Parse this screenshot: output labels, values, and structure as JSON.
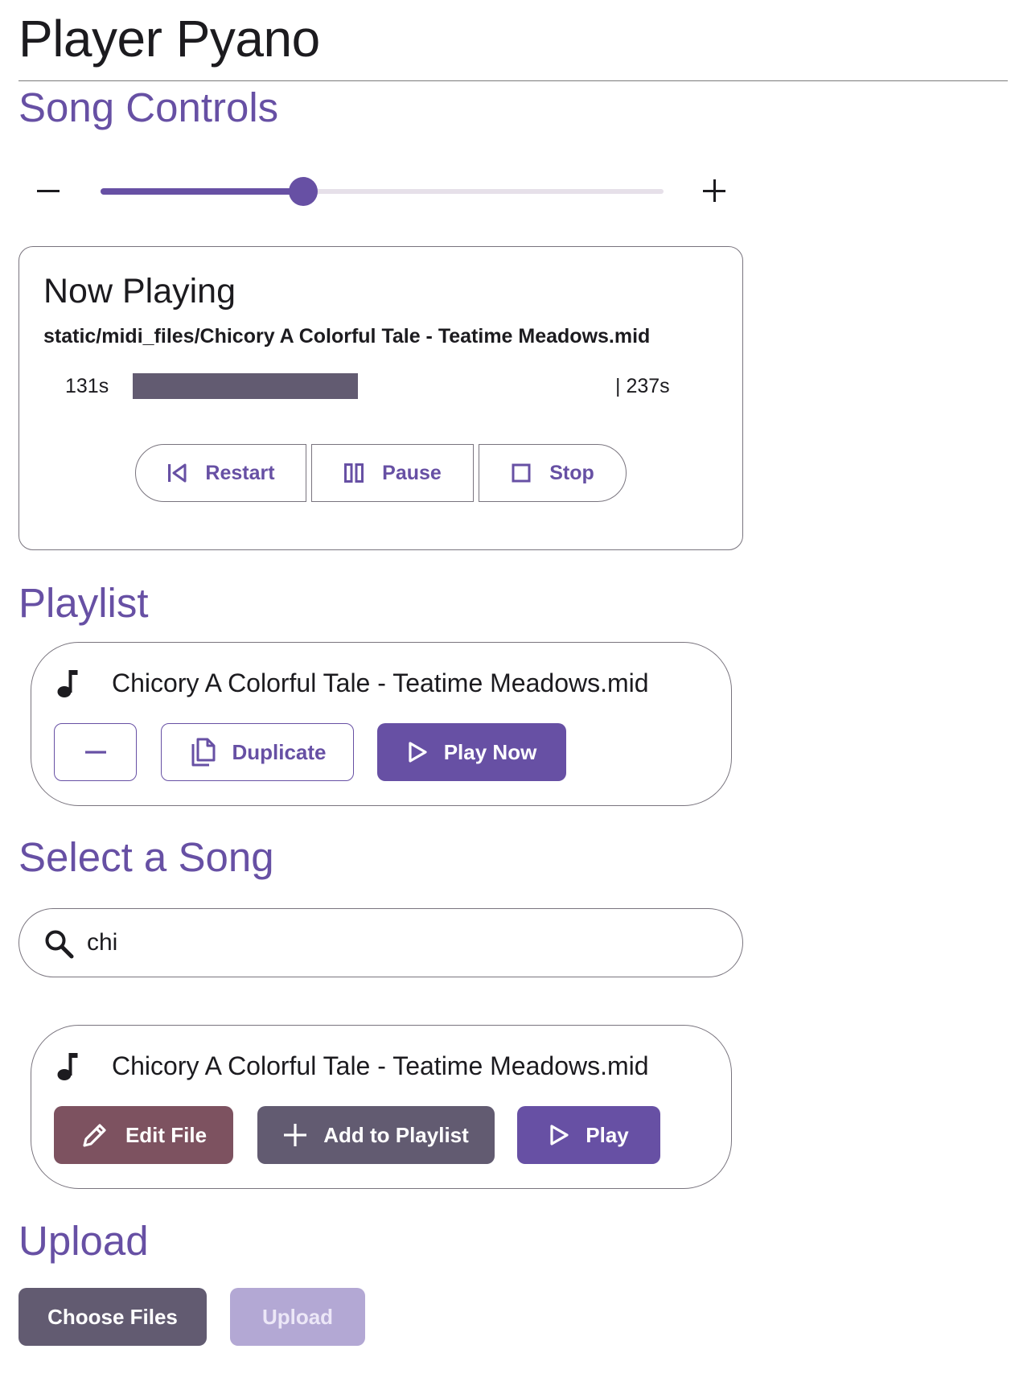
{
  "app": {
    "title": "Player Pyano"
  },
  "song_controls": {
    "heading": "Song Controls",
    "volume_fraction": 0.36,
    "decrease_icon": "minus-icon",
    "increase_icon": "plus-icon"
  },
  "now_playing": {
    "title": "Now Playing",
    "file_path": "static/midi_files/Chicory A Colorful Tale - Teatime Meadows.mid",
    "elapsed": "131s",
    "total": "| 237s",
    "progress_fraction": 0.47,
    "buttons": {
      "restart": "Restart",
      "pause": "Pause",
      "stop": "Stop"
    }
  },
  "playlist": {
    "heading": "Playlist",
    "items": [
      {
        "name": "Chicory A Colorful Tale - Teatime Meadows.mid",
        "icon": "music-note-icon",
        "duplicate_label": "Duplicate",
        "play_now_label": "Play Now"
      }
    ]
  },
  "select_song": {
    "heading": "Select a Song",
    "search_value": "chi",
    "results": [
      {
        "name": "Chicory A Colorful Tale - Teatime Meadows.mid",
        "icon": "music-note-icon",
        "edit_label": "Edit File",
        "add_label": "Add to Playlist",
        "play_label": "Play"
      }
    ]
  },
  "upload": {
    "heading": "Upload",
    "choose_label": "Choose Files",
    "upload_label": "Upload"
  },
  "colors": {
    "primary": "#6750a4",
    "secondary": "#625b71",
    "tertiary": "#7d5260",
    "outline": "#79747e",
    "disabled": "#b3a8d4"
  }
}
